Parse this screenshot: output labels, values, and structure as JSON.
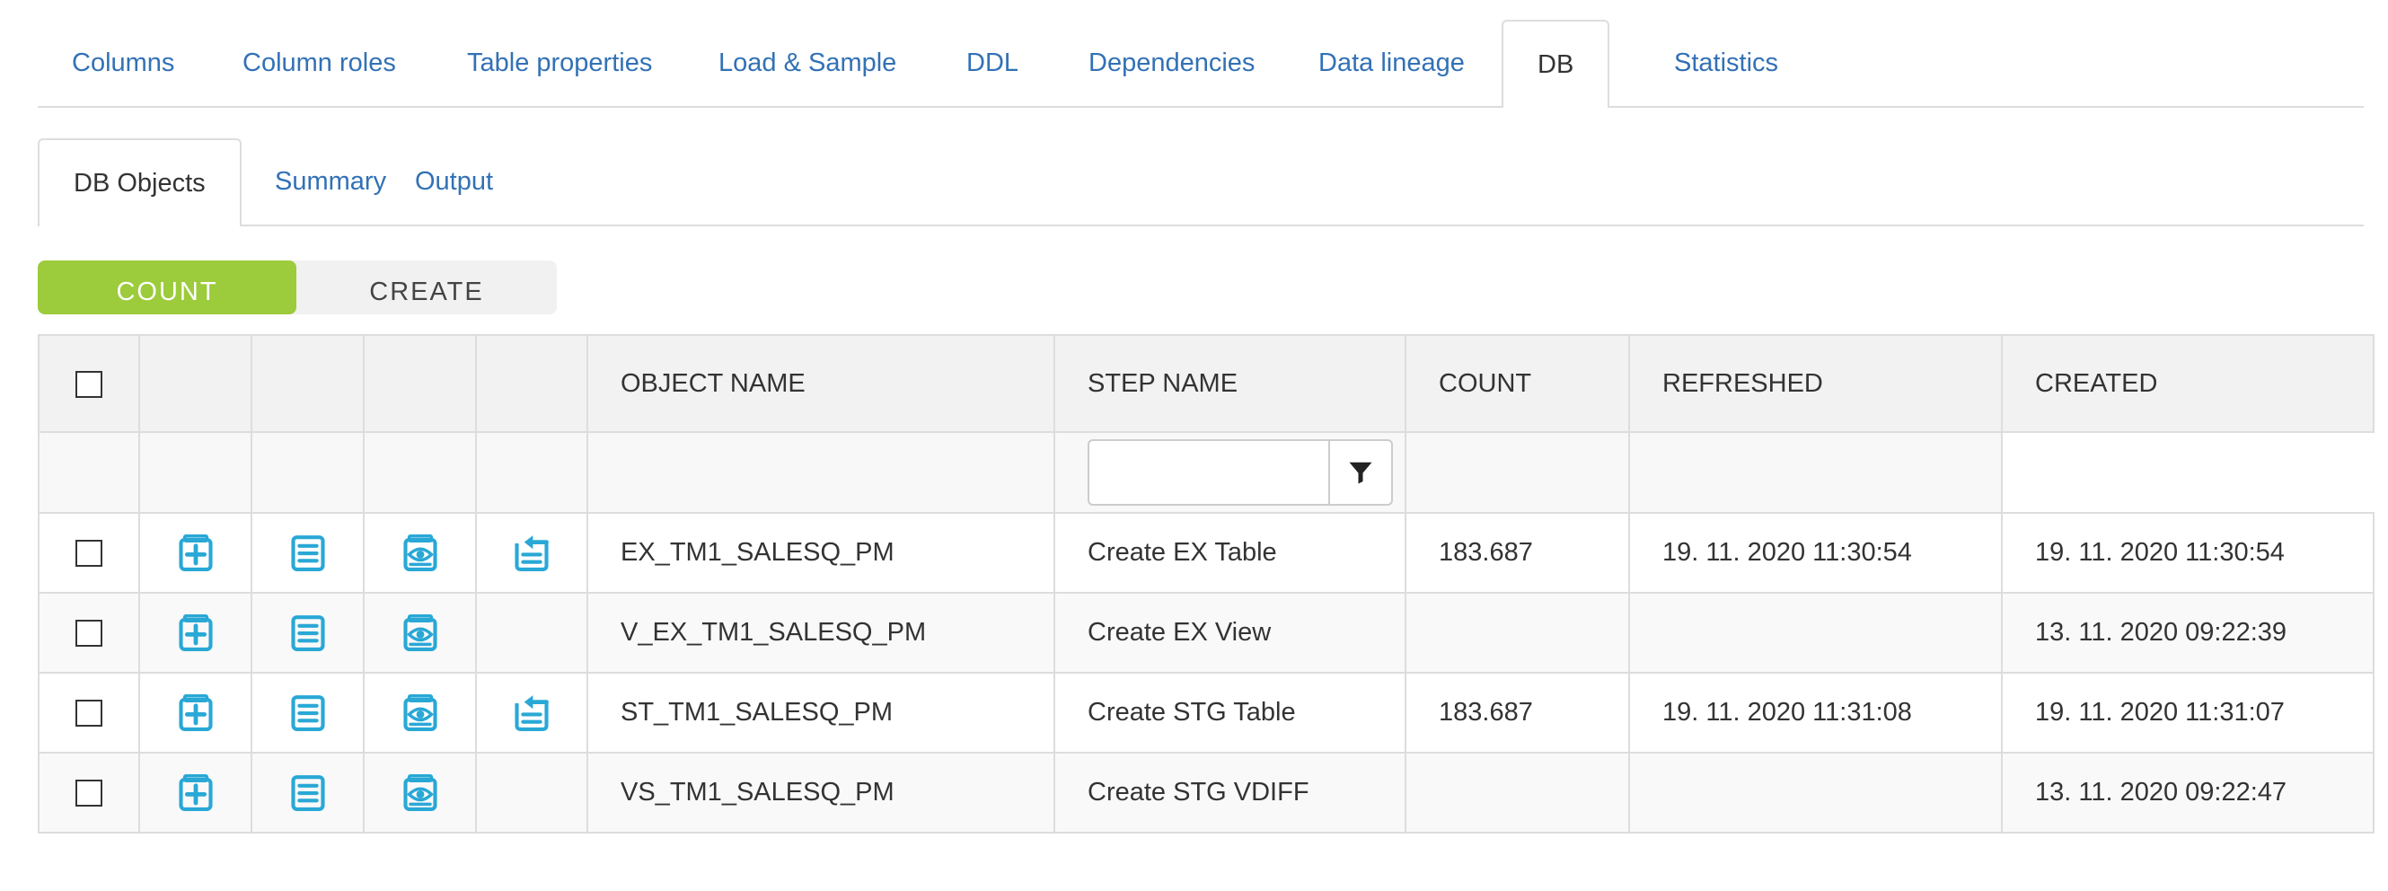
{
  "main_tabs": [
    {
      "label": "Columns",
      "active": false
    },
    {
      "label": "Column roles",
      "active": false
    },
    {
      "label": "Table properties",
      "active": false
    },
    {
      "label": "Load & Sample",
      "active": false
    },
    {
      "label": "DDL",
      "active": false
    },
    {
      "label": "Dependencies",
      "active": false
    },
    {
      "label": "Data lineage",
      "active": false
    },
    {
      "label": "DB",
      "active": true
    },
    {
      "label": "Statistics",
      "active": false
    }
  ],
  "sub_tabs": [
    {
      "label": "DB Objects",
      "active": true
    },
    {
      "label": "Summary",
      "active": false
    },
    {
      "label": "Output",
      "active": false
    }
  ],
  "toggle": {
    "count_label": "COUNT",
    "create_label": "CREATE",
    "selected": "COUNT"
  },
  "table": {
    "headers": {
      "object_name": "OBJECT NAME",
      "step_name": "STEP NAME",
      "count": "COUNT",
      "refreshed": "REFRESHED",
      "created": "CREATED"
    },
    "filter": {
      "step_name_value": "",
      "placeholder": ""
    },
    "rows": [
      {
        "object_name": "EX_TM1_SALESQ_PM",
        "step_name": "Create EX Table",
        "count": "183.687",
        "refreshed": "19. 11. 2020 11:30:54",
        "created": "19. 11. 2020 11:30:54"
      },
      {
        "object_name": "V_EX_TM1_SALESQ_PM",
        "step_name": "Create EX View",
        "count": "",
        "refreshed": "",
        "created": "13. 11. 2020 09:22:39"
      },
      {
        "object_name": "ST_TM1_SALESQ_PM",
        "step_name": "Create STG Table",
        "count": "183.687",
        "refreshed": "19. 11. 2020 11:31:08",
        "created": "19. 11. 2020 11:31:07"
      },
      {
        "object_name": "VS_TM1_SALESQ_PM",
        "step_name": "Create STG VDIFF",
        "count": "",
        "refreshed": "",
        "created": "13. 11. 2020 09:22:47"
      }
    ]
  },
  "icons": {
    "create": "add-document-icon",
    "detail": "list-document-icon",
    "preview": "eye-document-icon",
    "load": "import-arrow-icon",
    "filter": "funnel-filter-icon"
  },
  "colors": {
    "link": "#3271b5",
    "accent_green": "#9ccb3b",
    "icon": "#29a8d6",
    "border": "#dddddd",
    "header_bg": "#f2f2f2"
  }
}
